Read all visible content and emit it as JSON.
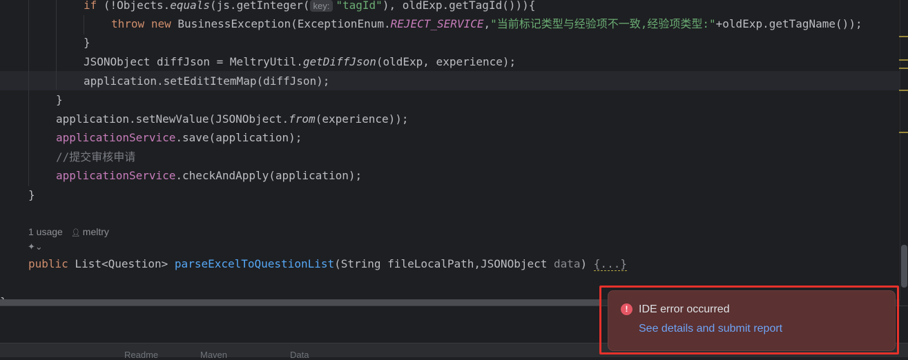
{
  "code": {
    "l1": {
      "a": "if",
      "b": " (!Objects.",
      "c": "equals",
      "d": "(js.getInteger(",
      "hint": "key:",
      "str": "\"tagId\"",
      "e": "), oldExp.getTagId())){"
    },
    "l2": {
      "kw1": "throw",
      "sp": " ",
      "kw2": "new",
      "a": " BusinessException(ExceptionEnum.",
      "const": "REJECT_SERVICE",
      "b": ",",
      "str": "\"当前标记类型与经验项不一致,经验项类型:\"",
      "c": "+oldExp.getTagName());"
    },
    "l3": "}",
    "l4": {
      "a": "JSONObject diffJson = MeltryUtil.",
      "fn": "getDiffJson",
      "b": "(oldExp, experience);"
    },
    "l5": "application.setEditItemMap(diffJson);",
    "l6": "}",
    "l7": {
      "a": "application.setNewValue(JSONObject.",
      "fn": "from",
      "b": "(experience));"
    },
    "l8": {
      "field": "applicationService",
      "b": ".save(application);"
    },
    "l9": "//提交审核申请",
    "l10": {
      "field": "applicationService",
      "b": ".checkAndApply(application);"
    },
    "l11": "}",
    "lens_usage": "1 usage",
    "lens_author": "meltry",
    "l12": {
      "kw": "public",
      "a": " List<Question> ",
      "fn": "parseExcelToQuestionList",
      "b": "(String fileLocalPath,JSONObject ",
      "param": "data",
      "c": ") ",
      "fold": "{...}"
    },
    "l13": "}"
  },
  "toolbar": {
    "items": [
      "Readme",
      "Maven",
      "Data"
    ]
  },
  "notification": {
    "icon": "!",
    "title": "IDE error occurred",
    "link": "See details and submit report"
  },
  "colors": {
    "keyword": "#cf8e6d",
    "string": "#6aab73",
    "function": "#56a8f5",
    "field": "#c77dbb",
    "error": "#e55765",
    "highlight_border": "#e6312b"
  }
}
